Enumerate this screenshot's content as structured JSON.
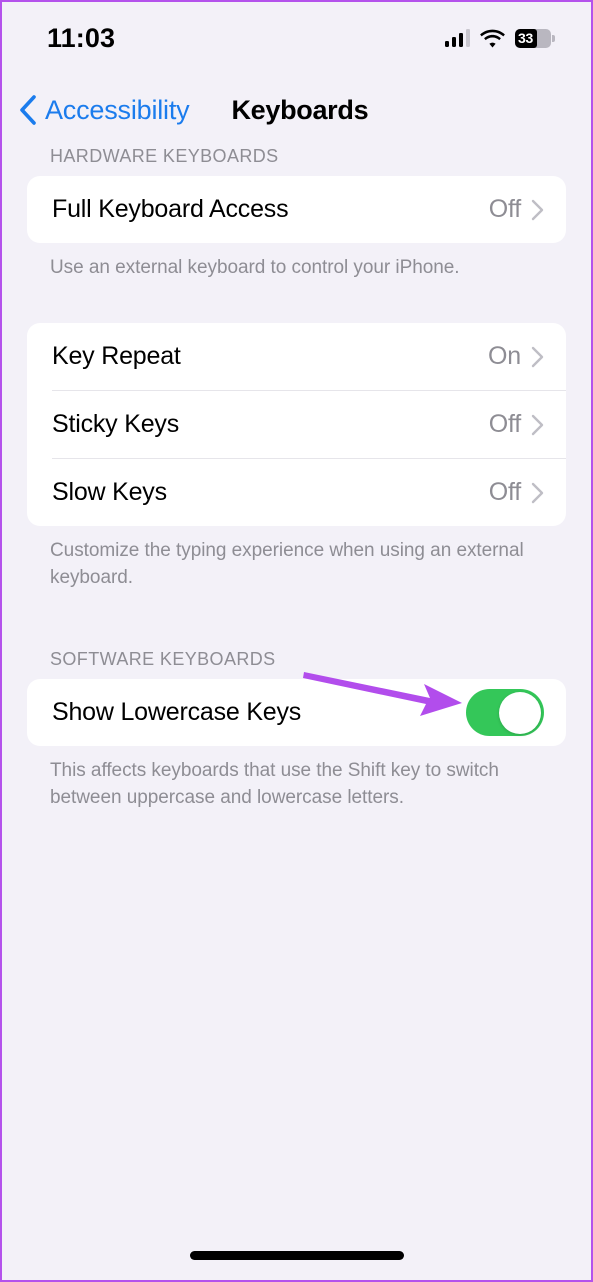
{
  "status_bar": {
    "time": "11:03",
    "cellular_icon": "cellular-signal-icon",
    "wifi_icon": "wifi-icon",
    "battery_icon": "battery-icon",
    "battery_level": "33"
  },
  "nav": {
    "back_icon": "chevron-left-icon",
    "back_label": "Accessibility",
    "title": "Keyboards"
  },
  "sections": [
    {
      "header": "HARDWARE KEYBOARDS",
      "rows": [
        {
          "label": "Full Keyboard Access",
          "value": "Off",
          "accessory": "chevron-right-icon"
        }
      ],
      "footnote": "Use an external keyboard to control your iPhone."
    },
    {
      "header": "",
      "rows": [
        {
          "label": "Key Repeat",
          "value": "On",
          "accessory": "chevron-right-icon"
        },
        {
          "label": "Sticky Keys",
          "value": "Off",
          "accessory": "chevron-right-icon"
        },
        {
          "label": "Slow Keys",
          "value": "Off",
          "accessory": "chevron-right-icon"
        }
      ],
      "footnote": "Customize the typing experience when using an external keyboard."
    },
    {
      "header": "SOFTWARE KEYBOARDS",
      "rows": [
        {
          "label": "Show Lowercase Keys",
          "value": "on",
          "accessory": "toggle-switch"
        }
      ],
      "footnote": "This affects keyboards that use the Shift key to switch between uppercase and lowercase letters."
    }
  ],
  "annotation": {
    "type": "arrow",
    "points_to": "show-lowercase-keys-toggle",
    "color": "#b24dec"
  },
  "colors": {
    "background": "#f3f1f8",
    "card": "#ffffff",
    "accent_blue": "#1b7ced",
    "toggle_on_green": "#34c759",
    "secondary_text": "#8e8d94",
    "annotation_purple": "#b24dec",
    "screenshot_border": "#b452ec"
  },
  "home_indicator": "home-indicator"
}
